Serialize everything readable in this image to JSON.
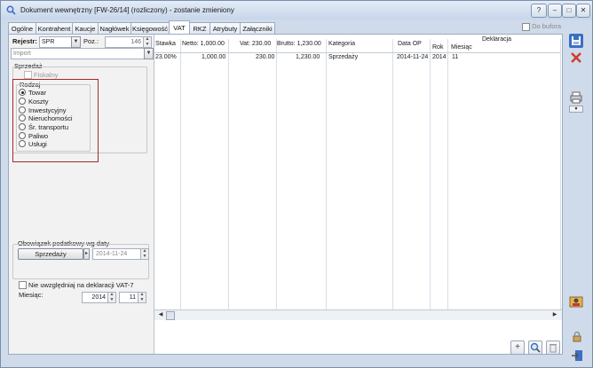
{
  "window": {
    "title": "Dokument wewnętrzny [FW-26/14] (rozliczony) - zostanie zmieniony",
    "min_label": "–",
    "max_label": "□",
    "close_label": "✕",
    "help_label": "?"
  },
  "tabs": [
    {
      "label": "Ogólne"
    },
    {
      "label": "Kontrahent"
    },
    {
      "label": "Kaucje"
    },
    {
      "label": "Nagłówek"
    },
    {
      "label": "Księgowość"
    },
    {
      "label": "VAT"
    },
    {
      "label": "RKZ"
    },
    {
      "label": "Atrybuty"
    },
    {
      "label": "Załączniki"
    }
  ],
  "active_tab": "VAT",
  "do_bufora": {
    "label": "Do bufora",
    "checked": false
  },
  "left": {
    "rejestr_label": "Rejestr:",
    "rejestr_value": "SPR",
    "poz_label": "Poz.:",
    "poz_value": "146",
    "import_value": "Import",
    "sprzedaz_label": "Sprzedaż",
    "fiskalny_label": "Fiskalny",
    "rodzaj_label": "Rodzaj",
    "rodzaj_options": [
      "Towar",
      "Koszty",
      "Inwestycyjny",
      "Nieruchomości",
      "Śr. transportu",
      "Paliwo",
      "Usługi"
    ],
    "rodzaj_selected": "Towar",
    "obowiazek_label": "Obowiązek podatkowy wg daty",
    "obowiazek_button": "Sprzedaży",
    "obowiazek_date": "2014-11-24",
    "nie_uwzgledniaj_label": "Nie uwzględniaj na deklaracji VAT-7",
    "miesiac_label": "Miesiąc:",
    "rok_value": "2014",
    "miesiac_value": "11"
  },
  "grid": {
    "headers": {
      "stawka": "Stawka",
      "netto": "Netto: 1,000.00",
      "vat": "Vat: 230.00",
      "brutto": "Brutto: 1,230.00",
      "kategoria": "Kategoria",
      "data_op": "Data OP",
      "deklaracja": "Deklaracja",
      "rok": "Rok",
      "miesiac": "Miesiąc"
    },
    "rows": [
      {
        "stawka": "23.00%",
        "netto": "1,000.00",
        "vat": "230.00",
        "brutto": "1,230.00",
        "kategoria": "Sprzedaży",
        "data_op": "2014-11-24",
        "rok": "2014",
        "miesiac": "11"
      }
    ]
  },
  "colors": {
    "accent": "#3a6fc4",
    "highlight_border": "#a52a2a",
    "delete": "#d33a2c"
  },
  "icons": [
    "app-icon",
    "save-icon",
    "delete-icon",
    "print-icon",
    "user-icon",
    "add-icon",
    "search-icon",
    "trash-icon",
    "lock-icon",
    "exit-icon"
  ]
}
